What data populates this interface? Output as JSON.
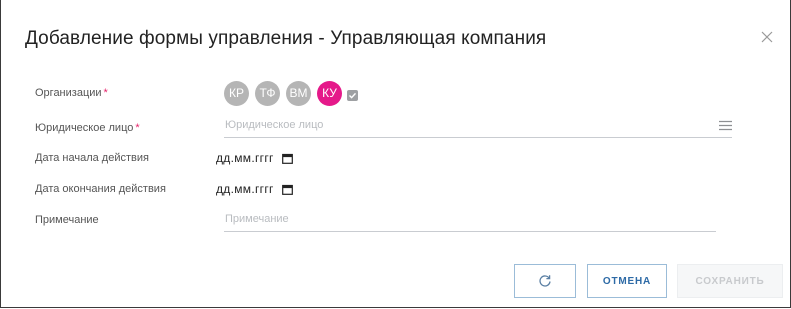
{
  "dialog": {
    "title": "Добавление формы управления - Управляющая компания",
    "close_icon": "close-icon"
  },
  "form": {
    "organizations": {
      "label": "Организации",
      "required_mark": "*",
      "chips": [
        {
          "abbr": "КР",
          "selected": false
        },
        {
          "abbr": "ТФ",
          "selected": false
        },
        {
          "abbr": "ВМ",
          "selected": false
        },
        {
          "abbr": "КУ",
          "selected": true
        }
      ]
    },
    "legal_entity": {
      "label": "Юридическое лицо",
      "required_mark": "*",
      "placeholder": "Юридическое лицо",
      "icon": "list-icon"
    },
    "start_date": {
      "label": "Дата начала действия",
      "value": "дд.мм.гггг",
      "icon": "calendar-icon"
    },
    "end_date": {
      "label": "Дата окончания действия",
      "value": "дд.мм.гггг",
      "icon": "calendar-icon"
    },
    "note": {
      "label": "Примечание",
      "placeholder": "Примечание"
    }
  },
  "footer": {
    "reset_icon": "refresh-icon",
    "cancel_label": "ОТМЕНА",
    "save_label": "СОХРАНИТЬ"
  },
  "colors": {
    "accent": "#e5198a",
    "chip_inactive": "#b5b5b5",
    "button_border": "#9bbcd8",
    "cancel_text": "#2d6aa6",
    "required": "#e5246b"
  }
}
